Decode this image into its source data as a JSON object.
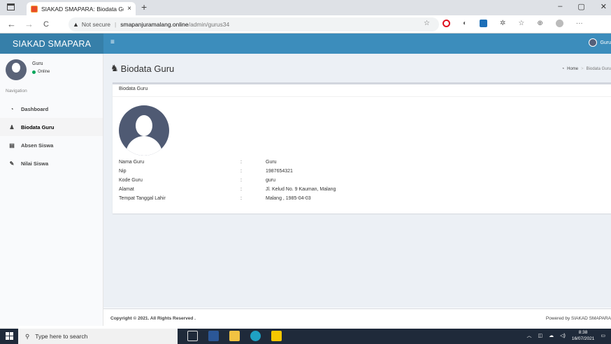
{
  "browser": {
    "tab_title": "SIAKAD SMAPARA: Biodata Guru",
    "tab_close": "×",
    "new_tab": "+",
    "security_label": "Not secure",
    "url_host": "smapanjuramalang.online",
    "url_path": "/admin/gurus34",
    "window_controls": [
      "–",
      "▢",
      "✕"
    ],
    "back_icon": "←",
    "forward_icon": "→",
    "reload_icon": "C"
  },
  "header": {
    "brand": "SIAKAD SMAPARA",
    "menu_icon": "≡",
    "user_name": "Guru"
  },
  "sidebar": {
    "user_name": "Guru",
    "user_status": "Online",
    "nav_header": "Navigation",
    "items": [
      {
        "label": "Dashboard",
        "icon": "dashboard-icon",
        "glyph": "◔"
      },
      {
        "label": "Biodata Guru",
        "icon": "user-icon",
        "glyph": "♟"
      },
      {
        "label": "Absen Siswa",
        "icon": "list-icon",
        "glyph": "▤"
      },
      {
        "label": "Nilai Siswa",
        "icon": "pencil-icon",
        "glyph": "✎"
      }
    ]
  },
  "page": {
    "title": "Biodata Guru",
    "title_icon": "♞",
    "breadcrumb": {
      "home": "Home",
      "separator": ">",
      "current": "Biodata Guru"
    },
    "box_title": "Biodata Guru",
    "fields": [
      {
        "label": "Nama Guru",
        "colon": ":",
        "value": "Guru"
      },
      {
        "label": "Nip",
        "colon": ":",
        "value": "1987654321"
      },
      {
        "label": "Kode Guru",
        "colon": ":",
        "value": "guru"
      },
      {
        "label": "Alamat",
        "colon": ":",
        "value": "Jl. Kelud No. 9 Kauman, Malang"
      },
      {
        "label": "Tempat Tanggal Lahir",
        "colon": ":",
        "value": "Malang , 1985-04-03"
      }
    ]
  },
  "footer": {
    "copyright": "Copyright © 2021. All Rights Reserved .",
    "powered_by": "Powered by SIAKAD SMAPARA"
  },
  "taskbar": {
    "search_placeholder": "Type here to search",
    "time": "8:38",
    "date": "16/07/2021"
  },
  "colors": {
    "header_blue": "#3c8dbc",
    "brand_blue": "#367fa9",
    "online_green": "#00a65a"
  }
}
